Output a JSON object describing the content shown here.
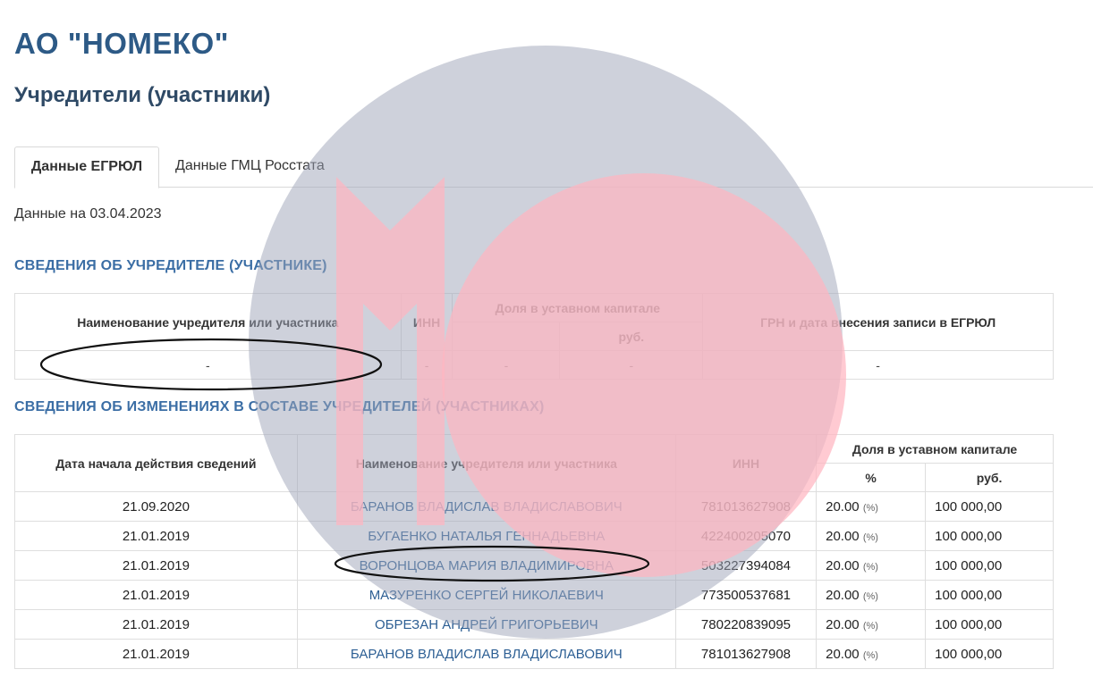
{
  "company": {
    "name": "АО \"НОМЕКО\""
  },
  "page": {
    "section_title": "Учредители (участники)"
  },
  "tabs": [
    {
      "label": "Данные ЕГРЮЛ"
    },
    {
      "label": "Данные ГМЦ Росстата"
    }
  ],
  "data_date": "Данные на 03.04.2023",
  "founder_section": {
    "title": "СВЕДЕНИЯ ОБ УЧРЕДИТЕЛЕ (УЧАСТНИКЕ)",
    "headers": {
      "name": "Наименование учредителя или участника",
      "inn": "ИНН",
      "share": "Доля в уставном капитале",
      "rub": "руб.",
      "grn": "ГРН и дата внесения записи в ЕГРЮЛ"
    },
    "row": {
      "name": "-",
      "inn": "-",
      "share_pct": "-",
      "share_rub": "-",
      "grn": "-"
    }
  },
  "changes_section": {
    "title": "СВЕДЕНИЯ ОБ ИЗМЕНЕНИЯХ В СОСТАВЕ УЧРЕДИТЕЛЕЙ (УЧАСТНИКАХ)",
    "headers": {
      "date": "Дата начала действия сведений",
      "name": "Наименование учредителя или участника",
      "inn": "ИНН",
      "share": "Доля в уставном капитале",
      "pct": "%",
      "rub": "руб."
    },
    "rows": [
      {
        "date": "21.09.2020",
        "name": "БАРАНОВ ВЛАДИСЛАВ ВЛАДИСЛАВОВИЧ",
        "inn": "781013627908",
        "pct": "20.00",
        "pct_suffix": "(%)",
        "rub": "100 000,00"
      },
      {
        "date": "21.01.2019",
        "name": "БУГАЕНКО НАТАЛЬЯ ГЕННАДЬЕВНА",
        "inn": "422400205070",
        "pct": "20.00",
        "pct_suffix": "(%)",
        "rub": "100 000,00"
      },
      {
        "date": "21.01.2019",
        "name": "ВОРОНЦОВА МАРИЯ ВЛАДИМИРОВНА",
        "inn": "503227394084",
        "pct": "20.00",
        "pct_suffix": "(%)",
        "rub": "100 000,00"
      },
      {
        "date": "21.01.2019",
        "name": "МАЗУРЕНКО СЕРГЕЙ НИКОЛАЕВИЧ",
        "inn": "773500537681",
        "pct": "20.00",
        "pct_suffix": "(%)",
        "rub": "100 000,00"
      },
      {
        "date": "21.01.2019",
        "name": "ОБРЕЗАН АНДРЕЙ ГРИГОРЬЕВИЧ",
        "inn": "780220839095",
        "pct": "20.00",
        "pct_suffix": "(%)",
        "rub": "100 000,00"
      },
      {
        "date": "21.01.2019",
        "name": "БАРАНОВ ВЛАДИСЛАВ ВЛАДИСЛАВОВИЧ",
        "inn": "781013627908",
        "pct": "20.00",
        "pct_suffix": "(%)",
        "rub": "100 000,00"
      }
    ]
  },
  "colors": {
    "title": "#2d5a86",
    "subhead": "#3b6ea5",
    "link": "#2d5f94",
    "watermark_circle": "#9ea3b8",
    "watermark_pink": "#ffb6c1"
  }
}
